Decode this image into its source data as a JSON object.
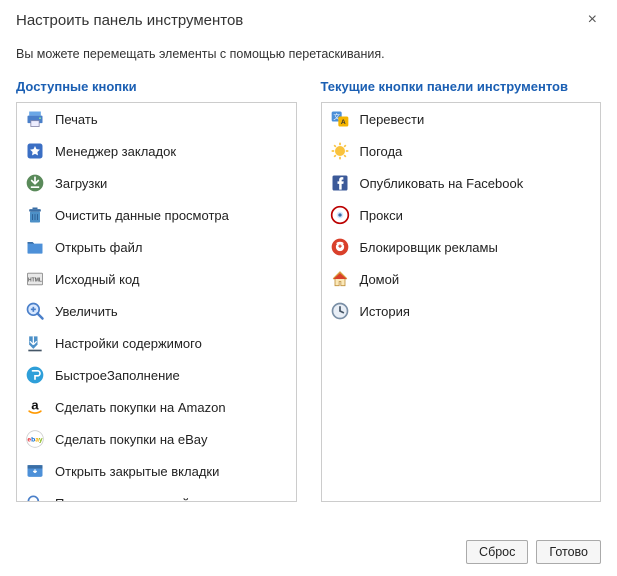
{
  "dialog": {
    "title": "Настроить панель инструментов",
    "subtitle": "Вы можете перемещать элементы с помощью перетаскивания.",
    "close_label": "×"
  },
  "columns": {
    "available_header": "Доступные кнопки",
    "current_header": "Текущие кнопки панели инструментов"
  },
  "available": [
    {
      "icon": "print-icon",
      "label": "Печать"
    },
    {
      "icon": "bookmark-icon",
      "label": "Менеджер закладок"
    },
    {
      "icon": "download-icon",
      "label": "Загрузки"
    },
    {
      "icon": "trash-icon",
      "label": "Очистить данные просмотра"
    },
    {
      "icon": "folder-icon",
      "label": "Открыть файл"
    },
    {
      "icon": "html-icon",
      "label": "Исходный код"
    },
    {
      "icon": "zoom-icon",
      "label": "Увеличить"
    },
    {
      "icon": "settings-dl-icon",
      "label": "Настройки содержимого"
    },
    {
      "icon": "autofill-icon",
      "label": "БыстроеЗаполнение"
    },
    {
      "icon": "amazon-icon",
      "label": "Сделать покупки на Amazon"
    },
    {
      "icon": "ebay-icon",
      "label": "Сделать покупки на eBay"
    },
    {
      "icon": "restore-icon",
      "label": "Открыть закрытые вкладки"
    },
    {
      "icon": "search-icon",
      "label": "Поиск на текущем сайте"
    }
  ],
  "current": [
    {
      "icon": "translate-icon",
      "label": "Перевести"
    },
    {
      "icon": "weather-icon",
      "label": "Погода"
    },
    {
      "icon": "facebook-icon",
      "label": "Опубликовать на Facebook"
    },
    {
      "icon": "proxy-icon",
      "label": "Прокси"
    },
    {
      "icon": "adblock-icon",
      "label": "Блокировщик рекламы"
    },
    {
      "icon": "home-icon",
      "label": "Домой"
    },
    {
      "icon": "history-icon",
      "label": "История"
    }
  ],
  "footer": {
    "reset": "Сброс",
    "done": "Готово"
  }
}
